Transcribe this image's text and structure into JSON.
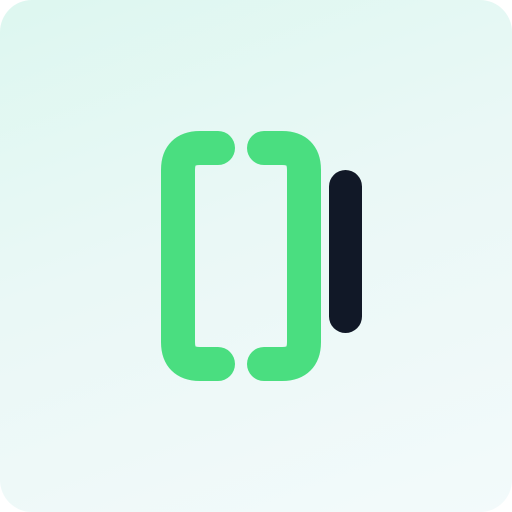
{
  "logo": {
    "icon": "bracket-bar-logo-icon",
    "bracket_color": "#4ade80",
    "bar_color": "#111827"
  },
  "background": {
    "gradient_start": "#ddf7f0",
    "gradient_end": "#f3fafb"
  }
}
